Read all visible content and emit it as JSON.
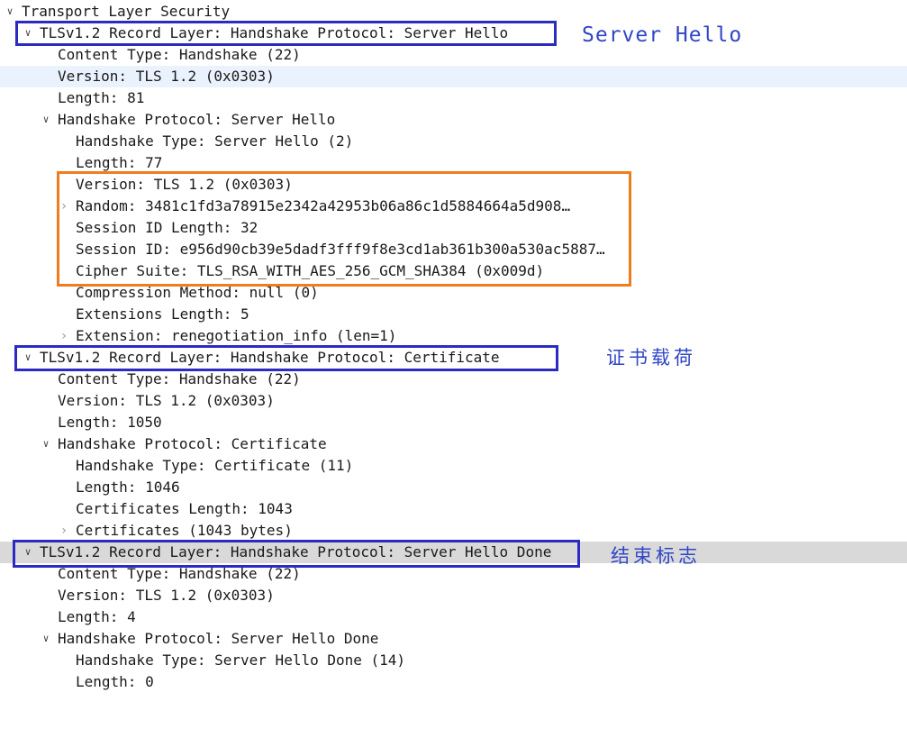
{
  "tree": [
    {
      "id": "r0",
      "indent": 0,
      "expand": "open",
      "text": "Transport Layer Security"
    },
    {
      "id": "r1",
      "indent": 1,
      "expand": "open",
      "text": "TLSv1.2 Record Layer: Handshake Protocol: Server Hello"
    },
    {
      "id": "r2",
      "indent": 2,
      "expand": "none",
      "text": "Content Type: Handshake (22)"
    },
    {
      "id": "r3",
      "indent": 2,
      "expand": "none",
      "text": "Version: TLS 1.2 (0x0303)",
      "selected": "light"
    },
    {
      "id": "r4",
      "indent": 2,
      "expand": "none",
      "text": "Length: 81"
    },
    {
      "id": "r5",
      "indent": 2,
      "expand": "open",
      "text": "Handshake Protocol: Server Hello"
    },
    {
      "id": "r6",
      "indent": 3,
      "expand": "none",
      "text": "Handshake Type: Server Hello (2)"
    },
    {
      "id": "r7",
      "indent": 3,
      "expand": "none",
      "text": "Length: 77"
    },
    {
      "id": "r8",
      "indent": 3,
      "expand": "none",
      "text": "Version: TLS 1.2 (0x0303)"
    },
    {
      "id": "r9",
      "indent": 3,
      "expand": "closed",
      "text": "Random: 3481c1fd3a78915e2342a42953b06a86c1d5884664a5d908…"
    },
    {
      "id": "r10",
      "indent": 3,
      "expand": "none",
      "text": "Session ID Length: 32"
    },
    {
      "id": "r11",
      "indent": 3,
      "expand": "none",
      "text": "Session ID: e956d90cb39e5dadf3fff9f8e3cd1ab361b300a530ac5887…"
    },
    {
      "id": "r12",
      "indent": 3,
      "expand": "none",
      "text": "Cipher Suite: TLS_RSA_WITH_AES_256_GCM_SHA384 (0x009d)"
    },
    {
      "id": "r13",
      "indent": 3,
      "expand": "none",
      "text": "Compression Method: null (0)"
    },
    {
      "id": "r14",
      "indent": 3,
      "expand": "none",
      "text": "Extensions Length: 5"
    },
    {
      "id": "r15",
      "indent": 3,
      "expand": "closed",
      "text": "Extension: renegotiation_info (len=1)"
    },
    {
      "id": "r16",
      "indent": 1,
      "expand": "open",
      "text": "TLSv1.2 Record Layer: Handshake Protocol: Certificate"
    },
    {
      "id": "r17",
      "indent": 2,
      "expand": "none",
      "text": "Content Type: Handshake (22)"
    },
    {
      "id": "r18",
      "indent": 2,
      "expand": "none",
      "text": "Version: TLS 1.2 (0x0303)"
    },
    {
      "id": "r19",
      "indent": 2,
      "expand": "none",
      "text": "Length: 1050"
    },
    {
      "id": "r20",
      "indent": 2,
      "expand": "open",
      "text": "Handshake Protocol: Certificate"
    },
    {
      "id": "r21",
      "indent": 3,
      "expand": "none",
      "text": "Handshake Type: Certificate (11)"
    },
    {
      "id": "r22",
      "indent": 3,
      "expand": "none",
      "text": "Length: 1046"
    },
    {
      "id": "r23",
      "indent": 3,
      "expand": "none",
      "text": "Certificates Length: 1043"
    },
    {
      "id": "r24",
      "indent": 3,
      "expand": "closed",
      "text": "Certificates (1043 bytes)"
    },
    {
      "id": "r25",
      "indent": 1,
      "expand": "open",
      "text": "TLSv1.2 Record Layer: Handshake Protocol: Server Hello Done",
      "selected": "grey"
    },
    {
      "id": "r26",
      "indent": 2,
      "expand": "none",
      "text": "Content Type: Handshake (22)"
    },
    {
      "id": "r27",
      "indent": 2,
      "expand": "none",
      "text": "Version: TLS 1.2 (0x0303)"
    },
    {
      "id": "r28",
      "indent": 2,
      "expand": "none",
      "text": "Length: 4"
    },
    {
      "id": "r29",
      "indent": 2,
      "expand": "open",
      "text": "Handshake Protocol: Server Hello Done"
    },
    {
      "id": "r30",
      "indent": 3,
      "expand": "none",
      "text": "Handshake Type: Server Hello Done (14)"
    },
    {
      "id": "r31",
      "indent": 3,
      "expand": "none",
      "text": "Length: 0"
    }
  ],
  "annotations": {
    "server_hello": "Server Hello",
    "certificate_payload": "证书载荷",
    "end_marker": "结束标志"
  },
  "colors": {
    "record_box": "#2b2bc4",
    "hello_fields_box": "#ef7c1e",
    "annotation_text": "#2f46c6",
    "selected_row": "#d9d9d9",
    "hover_row": "#eaf3fd"
  },
  "icons": {
    "expanded": "chevron-down-icon",
    "collapsed": "chevron-right-icon"
  }
}
